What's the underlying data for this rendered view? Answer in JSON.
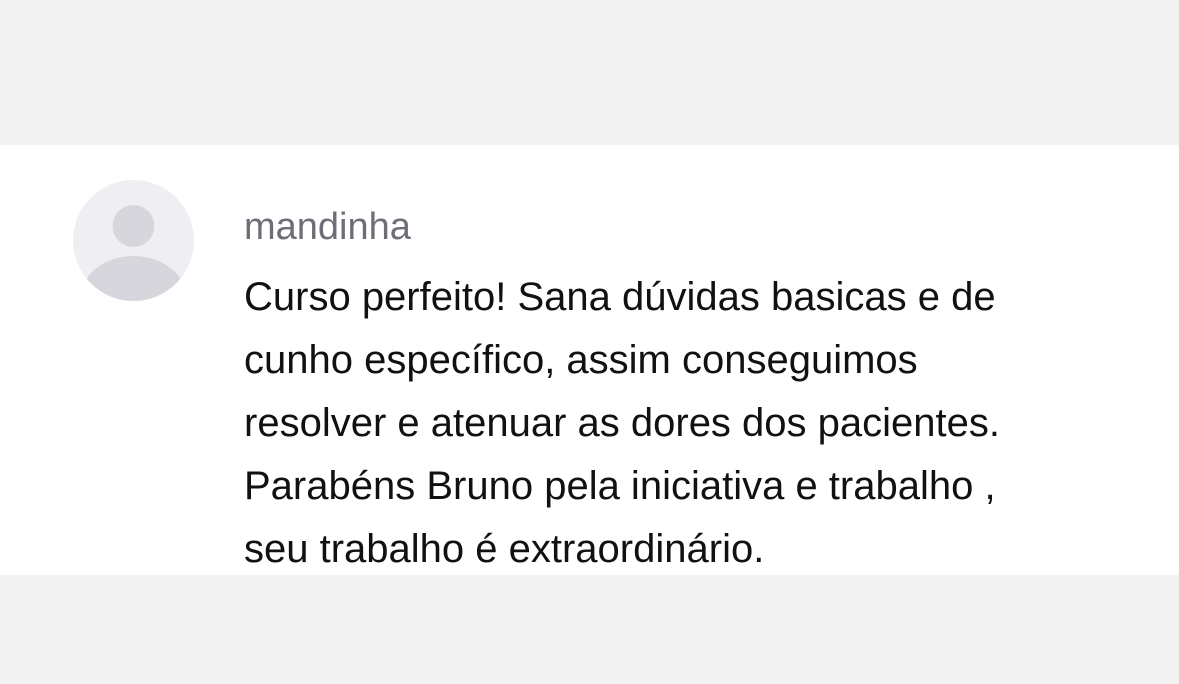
{
  "comment": {
    "author": "mandinha",
    "avatar_icon": "user-placeholder-icon",
    "text_lines": [
      "Curso perfeito! Sana dúvidas basicas e de",
      "cunho específico, assim conseguimos",
      "resolver e atenuar as dores dos pacientes.",
      "Parabéns Bruno pela iniciativa e trabalho ,",
      "seu trabalho é extraordinário."
    ]
  },
  "colors": {
    "page_background": "#f2f2f2",
    "card_background": "#ffffff",
    "avatar_background": "#efeff3",
    "avatar_figure": "#d6d6dc",
    "author_text": "#6e6e78",
    "body_text": "#111111"
  }
}
